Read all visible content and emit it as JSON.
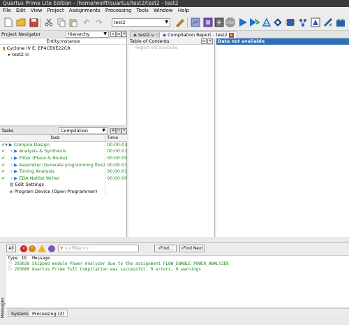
{
  "window": {
    "title": "Quartus Prime Lite Edition - /home/wolff/quartus/test2/test2 - test2"
  },
  "menu": {
    "items": [
      "File",
      "Edit",
      "View",
      "Project",
      "Assignments",
      "Processing",
      "Tools",
      "Window",
      "Help"
    ],
    "mnemonics": [
      "F",
      "E",
      "V",
      "P",
      "A",
      "P",
      "T",
      "W",
      "H"
    ]
  },
  "toolbar": {
    "project_select": "test2",
    "stop_label": "STOP"
  },
  "project_navigator": {
    "title": "Project Navigator",
    "view_select": "Hierarchy",
    "column_header": "Entity:Instance",
    "device": "Cyclone IV E: EP4CE6E22C8",
    "entity": "test2"
  },
  "tasks": {
    "title": "Tasks",
    "flow_select": "Compilation",
    "headers": {
      "task": "Task",
      "time": "Time"
    },
    "rows": [
      {
        "status": "✔",
        "name": "Compile Design",
        "time": "00:00:03",
        "level": 0
      },
      {
        "status": "✔",
        "name": "Analysis & Synthesis",
        "time": "00:00:01",
        "level": 1
      },
      {
        "status": "✔",
        "name": "Fitter (Place & Route)",
        "time": "00:00:00",
        "level": 1
      },
      {
        "status": "✔",
        "name": "Assembler (Generate programming files)",
        "time": "00:00:01",
        "level": 1
      },
      {
        "status": "✔",
        "name": "Timing Analysis",
        "time": "00:00:01",
        "level": 1
      },
      {
        "status": "✔",
        "name": "EDA Netlist Writer",
        "time": "00:00:00",
        "level": 1
      }
    ],
    "extra_rows": [
      {
        "name": "Edit Settings"
      },
      {
        "name": "Program Device (Open Programmer)"
      }
    ]
  },
  "editor_tabs": [
    {
      "label": "test2.v"
    },
    {
      "label": "Compilation Report - test2"
    }
  ],
  "report": {
    "toc_title": "Table of Contents",
    "toc_item": "Report not available",
    "content_header": "Data not available"
  },
  "messages": {
    "filter_all": "All",
    "filter_placeholder": "<<Filter>>",
    "find_label": "Find...",
    "find_next_label": "Find Next",
    "columns": {
      "type": "Type",
      "id": "ID",
      "message": "Message"
    },
    "rows": [
      {
        "id": "293026",
        "text": "Skipped module Power Analyzer due to the assignment FLOW_ENABLE_POWER_ANALYZER"
      },
      {
        "id": "293000",
        "text": "Quartus Prime Full Compilation was successful. 0 errors, 0 warnings"
      }
    ],
    "side_label": "Messages",
    "bottom_tabs": [
      "System",
      "Processing (2)"
    ]
  },
  "colors": {
    "title_bar": "#3a3a3a",
    "report_header_bg": "#2f6fb7",
    "task_green": "#1a8a1a",
    "message_green": "#1f7f1f"
  }
}
